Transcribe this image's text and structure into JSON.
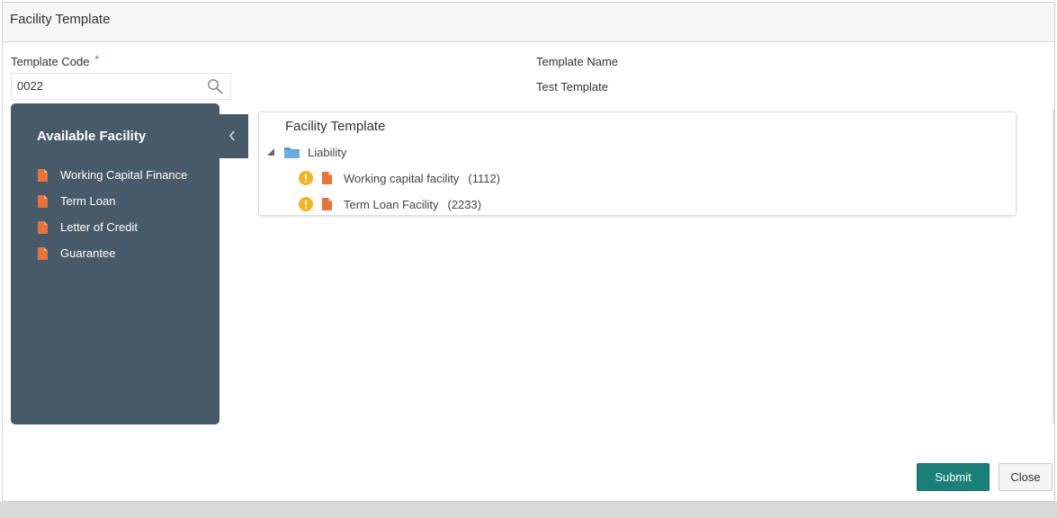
{
  "header": {
    "title": "Facility Template"
  },
  "form": {
    "template_code_label": "Template Code",
    "required_mark": "*",
    "template_code_value": "0022",
    "template_name_label": "Template Name",
    "template_name_value": "Test Template"
  },
  "available_panel": {
    "title": "Available Facility",
    "items": [
      {
        "label": "Working Capital Finance",
        "icon": "document-icon"
      },
      {
        "label": "Term Loan",
        "icon": "document-icon"
      },
      {
        "label": "Letter of Credit",
        "icon": "document-icon"
      },
      {
        "label": "Guarantee",
        "icon": "document-icon"
      }
    ],
    "collapse_icon": "chevron-left-icon"
  },
  "template_tree": {
    "title": "Facility Template",
    "root": {
      "label": "Liability",
      "icon": "folder-icon"
    },
    "children": [
      {
        "label": "Working capital facility",
        "code": "(1112)",
        "status_icon": "warning-icon",
        "icon": "document-icon"
      },
      {
        "label": "Term Loan Facility",
        "code": "(2233)",
        "status_icon": "warning-icon",
        "icon": "document-icon"
      }
    ]
  },
  "footer": {
    "submit_label": "Submit",
    "close_label": "Close"
  },
  "colors": {
    "panel_bg": "#475a69",
    "accent_orange": "#e8733a",
    "warning": "#f5b324",
    "folder_blue": "#4f9ad3",
    "submit_bg": "#1a7f76"
  }
}
